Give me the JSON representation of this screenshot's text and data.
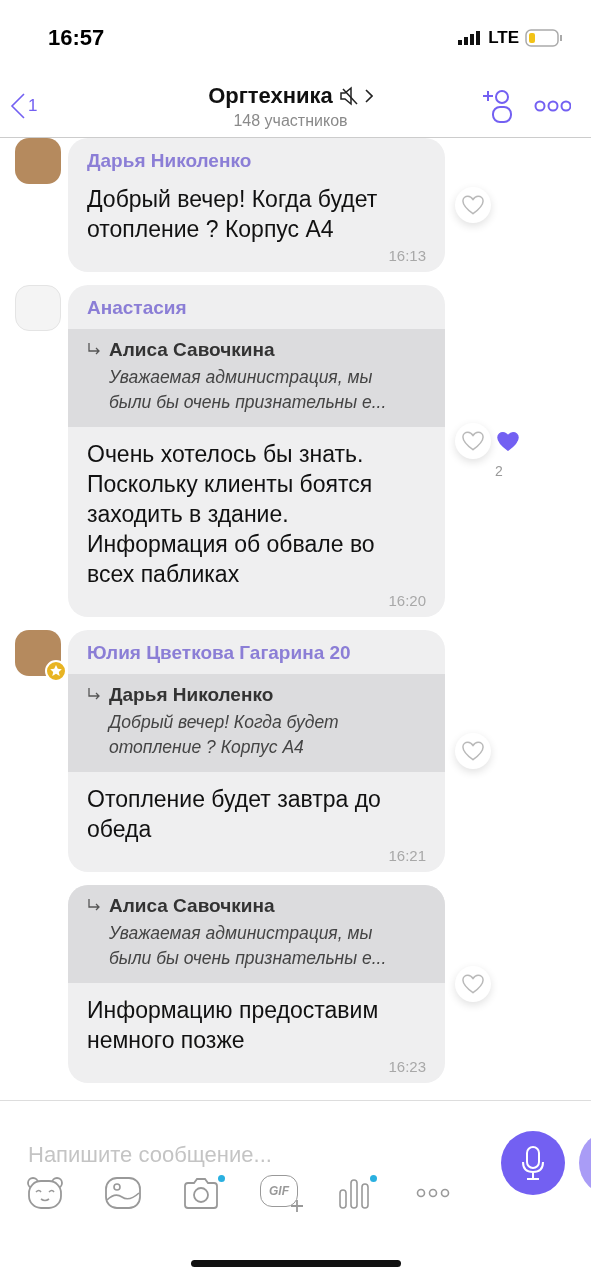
{
  "status_bar": {
    "time": "16:57",
    "network": "LTE"
  },
  "header": {
    "back_count": "1",
    "title": "Оргтехника",
    "muted": true,
    "subtitle": "148 участников"
  },
  "messages": [
    {
      "sender": {
        "name": "Дарья Николенко",
        "kind": "photo",
        "admin": false
      },
      "text": "Добрый вечер! Когда будет отопление ? Корпус А4",
      "time": "16:13",
      "reaction": {
        "liked": false,
        "others": false
      }
    },
    {
      "sender": {
        "name": "Анастасия",
        "kind": "logo",
        "admin": false
      },
      "reply": {
        "author": "Алиса Савочкина",
        "text": "Уважаемая администрация, мы были бы очень признательны е..."
      },
      "text": "Очень хотелось бы знать. Поскольку клиенты боятся заходить в здание. Информация об обвале во всех пабликах",
      "time": "16:20",
      "reaction": {
        "liked": false,
        "others": true,
        "count": "2"
      }
    },
    {
      "sender": {
        "name": "Юлия Цветкова Гагарина 20",
        "kind": "photo",
        "admin": true
      },
      "reply": {
        "author": "Дарья Николенко",
        "text": "Добрый вечер! Когда будет отопление ? Корпус А4"
      },
      "text": "Отопление будет завтра до обеда",
      "time": "16:21",
      "reaction": {
        "liked": false,
        "others": false
      }
    },
    {
      "reply": {
        "author": "Алиса Савочкина",
        "text": "Уважаемая администрация, мы были бы очень признательны е..."
      },
      "text": "Информацию предоставим немного позже",
      "time": "16:23",
      "reaction": {
        "liked": false,
        "others": false
      }
    }
  ],
  "composer": {
    "placeholder": "Напишите сообщение...",
    "tools": [
      {
        "kind": "sticker",
        "dot": false
      },
      {
        "kind": "gallery",
        "dot": false
      },
      {
        "kind": "camera",
        "dot": true
      },
      {
        "kind": "gif",
        "label": "GIF",
        "dot": false
      },
      {
        "kind": "voice",
        "dot": true
      },
      {
        "kind": "more",
        "dot": false
      }
    ]
  }
}
